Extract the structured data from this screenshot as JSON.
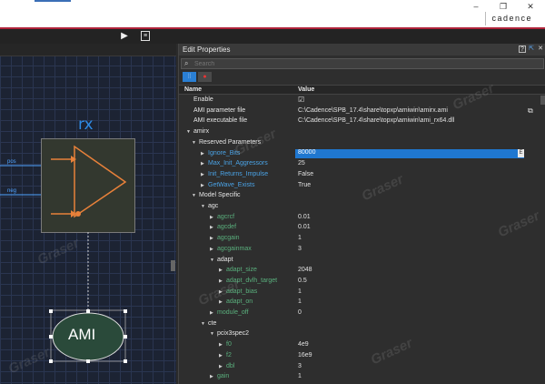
{
  "app": {
    "brand": "cadence"
  },
  "window_controls": {
    "minimize": "–",
    "maximize": "❐",
    "close": "✕"
  },
  "toolbar": {
    "run_icon": "play-icon",
    "doc_icon": "document-icon"
  },
  "canvas": {
    "block_label": "rx",
    "pin_pos": "pos",
    "pin_neg": "neg",
    "model_label": "AMI"
  },
  "panel": {
    "title": "Edit Properties",
    "title_buttons": [
      "?",
      "⇱",
      "✕"
    ],
    "search_placeholder": "Search",
    "columns": {
      "name": "Name",
      "value": "Value"
    },
    "rows": [
      {
        "name": "Enable",
        "value": "☑",
        "depth": 0,
        "arrow": "",
        "color": "white",
        "kind": "check"
      },
      {
        "name": "AMI parameter file",
        "value": "C:\\Cadence\\SPB_17.4\\share\\topxp\\amiwin\\amirx.ami",
        "depth": 0,
        "arrow": "",
        "color": "white",
        "kind": "file"
      },
      {
        "name": "AMI executable file",
        "value": "C:\\Cadence\\SPB_17.4\\share\\topxp\\amiwin\\ami_rx64.dll",
        "depth": 0,
        "arrow": "",
        "color": "white"
      },
      {
        "name": "amirx",
        "value": "",
        "depth": 0,
        "arrow": "▼",
        "color": "white"
      },
      {
        "name": "Reserved Parameters",
        "value": "",
        "depth": 1,
        "arrow": "▼",
        "color": "white"
      },
      {
        "name": "Ignore_Bits",
        "value": "80000",
        "depth": 2,
        "arrow": "▶",
        "color": "blue",
        "kind": "selected"
      },
      {
        "name": "Max_Init_Aggressors",
        "value": "25",
        "depth": 2,
        "arrow": "▶",
        "color": "blue"
      },
      {
        "name": "Init_Returns_Impulse",
        "value": "False",
        "depth": 2,
        "arrow": "▶",
        "color": "blue"
      },
      {
        "name": "GetWave_Exists",
        "value": "True",
        "depth": 2,
        "arrow": "▶",
        "color": "blue"
      },
      {
        "name": "Model Specific",
        "value": "",
        "depth": 1,
        "arrow": "▼",
        "color": "white"
      },
      {
        "name": "agc",
        "value": "",
        "depth": 2,
        "arrow": "▼",
        "color": "white"
      },
      {
        "name": "agcrcf",
        "value": "0.01",
        "depth": 3,
        "arrow": "▶",
        "color": "green"
      },
      {
        "name": "agcdef",
        "value": "0.01",
        "depth": 3,
        "arrow": "▶",
        "color": "green"
      },
      {
        "name": "agcgain",
        "value": "1",
        "depth": 3,
        "arrow": "▶",
        "color": "green"
      },
      {
        "name": "agcgainmax",
        "value": "3",
        "depth": 3,
        "arrow": "▶",
        "color": "green"
      },
      {
        "name": "adapt",
        "value": "",
        "depth": 3,
        "arrow": "▼",
        "color": "white"
      },
      {
        "name": "adapt_size",
        "value": "2048",
        "depth": 4,
        "arrow": "▶",
        "color": "green"
      },
      {
        "name": "adapt_dvlh_target",
        "value": "0.5",
        "depth": 4,
        "arrow": "▶",
        "color": "green"
      },
      {
        "name": "adapt_bias",
        "value": "1",
        "depth": 4,
        "arrow": "▶",
        "color": "green"
      },
      {
        "name": "adapt_on",
        "value": "1",
        "depth": 4,
        "arrow": "▶",
        "color": "green"
      },
      {
        "name": "module_off",
        "value": "0",
        "depth": 3,
        "arrow": "▶",
        "color": "green"
      },
      {
        "name": "cte",
        "value": "",
        "depth": 2,
        "arrow": "▼",
        "color": "white"
      },
      {
        "name": "pcix3spec2",
        "value": "",
        "depth": 3,
        "arrow": "▼",
        "color": "white"
      },
      {
        "name": "f0",
        "value": "4e9",
        "depth": 4,
        "arrow": "▶",
        "color": "green"
      },
      {
        "name": "f2",
        "value": "16e9",
        "depth": 4,
        "arrow": "▶",
        "color": "green"
      },
      {
        "name": "dbl",
        "value": "3",
        "depth": 4,
        "arrow": "▶",
        "color": "green"
      },
      {
        "name": "gain",
        "value": "1",
        "depth": 3,
        "arrow": "▶",
        "color": "green"
      }
    ]
  },
  "watermark": "Graser",
  "colors": {
    "accent": "#1f77d0",
    "brand_bar": "#b0243a",
    "node_blue": "#4aa3e6",
    "node_green": "#5ab07d",
    "amp": "#e8813a"
  }
}
